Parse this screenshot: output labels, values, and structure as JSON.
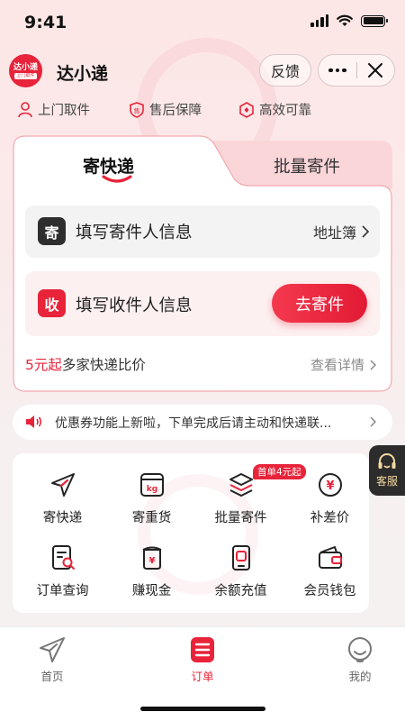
{
  "status_bar": {
    "time": "9:41"
  },
  "header": {
    "logo_text": "达小递",
    "logo_subtext": "上门取件",
    "app_name": "达小递",
    "feedback_label": "反馈",
    "more_icon": "more-dots-icon",
    "close_icon": "close-icon"
  },
  "features": [
    {
      "icon": "person-icon",
      "label": "上门取件"
    },
    {
      "icon": "shield-icon",
      "label": "售后保障"
    },
    {
      "icon": "diamond-shield-icon",
      "label": "高效可靠"
    }
  ],
  "tabs": [
    {
      "label": "寄快递",
      "active": true
    },
    {
      "label": "批量寄件",
      "active": false
    }
  ],
  "sender": {
    "badge": "寄",
    "label": "填写寄件人信息",
    "address_book": "地址簿"
  },
  "receiver": {
    "badge": "收",
    "label": "填写收件人信息",
    "button": "去寄件"
  },
  "compare": {
    "price": "5元起",
    "text": "多家快递比价",
    "details": "查看详情"
  },
  "notice": {
    "text": "优惠券功能上新啦，下单完成后请主动和快递联..."
  },
  "service": {
    "label": "客服"
  },
  "services": [
    {
      "label": "寄快递",
      "icon": "paper-plane-icon"
    },
    {
      "label": "寄重货",
      "icon": "scale-kg-icon"
    },
    {
      "label": "批量寄件",
      "icon": "stack-icon",
      "tag": "首单4元起"
    },
    {
      "label": "补差价",
      "icon": "yuan-circle-icon"
    },
    {
      "label": "订单查询",
      "icon": "order-search-icon"
    },
    {
      "label": "赚现金",
      "icon": "money-jar-icon"
    },
    {
      "label": "余额充值",
      "icon": "phone-recharge-icon"
    },
    {
      "label": "会员钱包",
      "icon": "wallet-icon"
    }
  ],
  "nav": [
    {
      "label": "首页",
      "icon": "paper-plane-icon",
      "active": false
    },
    {
      "label": "订单",
      "icon": "order-list-icon",
      "active": true
    },
    {
      "label": "我的",
      "icon": "profile-face-icon",
      "active": false
    }
  ],
  "colors": {
    "accent": "#e8233a",
    "dark": "#2e2e2e"
  }
}
